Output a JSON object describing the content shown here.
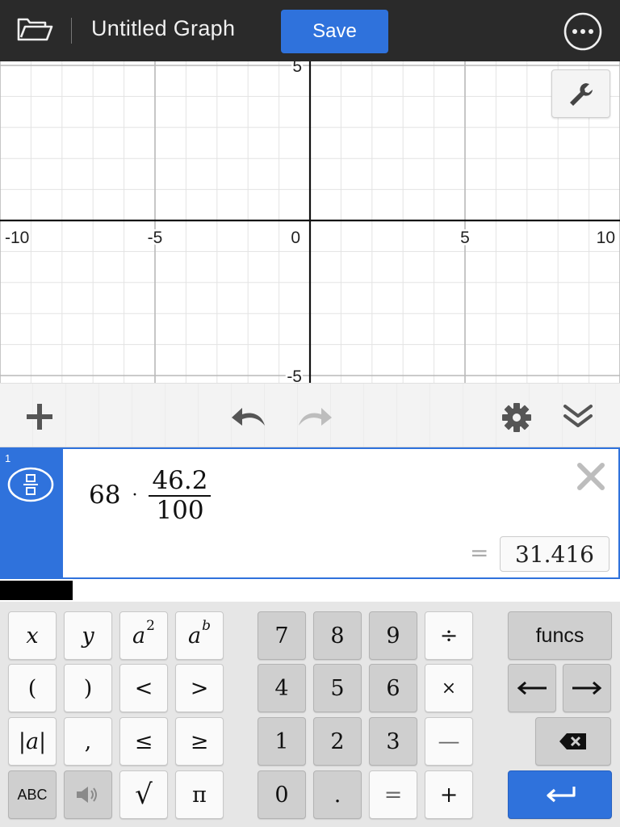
{
  "header": {
    "title": "Untitled Graph",
    "save_label": "Save"
  },
  "graph": {
    "x_range": [
      -10,
      10
    ],
    "y_range": [
      -6.3,
      6.3
    ],
    "x_tick_labels": [
      "-10",
      "-5",
      "0",
      "5",
      "10"
    ],
    "y_tick_labels": [
      "5",
      "-5"
    ],
    "grid": true,
    "settings_icon": "wrench-icon"
  },
  "toolbar": {
    "icons": [
      "plus-icon",
      "undo-icon",
      "redo-icon",
      "gear-icon",
      "collapse-icon"
    ]
  },
  "expression": {
    "index": "1",
    "coefficient": "68",
    "operator": "·",
    "numerator": "46.2",
    "denominator": "100",
    "equals": "=",
    "result": "31.416"
  },
  "keypad": {
    "row1": [
      "x",
      "y",
      "a",
      "2",
      "a",
      "b",
      "7",
      "8",
      "9",
      "÷",
      "funcs"
    ],
    "row2": [
      "(",
      ")",
      "<",
      ">",
      "4",
      "5",
      "6",
      "×"
    ],
    "row3": [
      "|a|",
      ",",
      "≤",
      "≥",
      "1",
      "2",
      "3",
      "—"
    ],
    "row4": [
      "ABC",
      "√",
      "π",
      "0",
      ".",
      "=",
      "+"
    ]
  },
  "colors": {
    "topbar": "#2a2a2a",
    "accent": "#2f72dc",
    "axis": "#111111",
    "grid_major": "#b9b9b9",
    "grid_minor": "#e3e3e3"
  }
}
